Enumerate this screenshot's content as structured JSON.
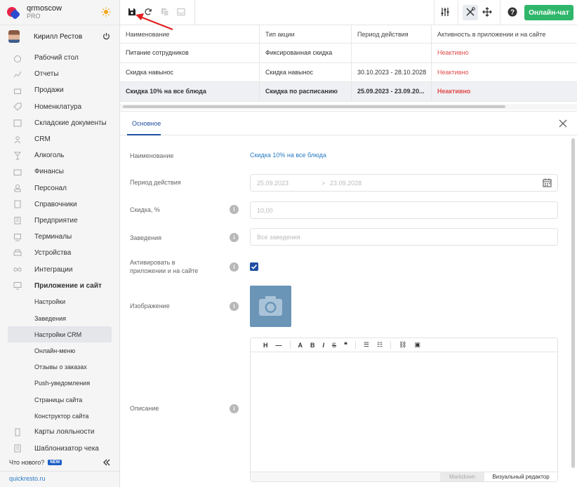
{
  "org": {
    "name": "qrmoscow",
    "plan": "PRO"
  },
  "user": {
    "name": "Кирилл Рестов"
  },
  "nav": {
    "items": [
      {
        "label": "Рабочий стол"
      },
      {
        "label": "Отчеты"
      },
      {
        "label": "Продажи"
      },
      {
        "label": "Номенклатура"
      },
      {
        "label": "Складские документы"
      },
      {
        "label": "CRM"
      },
      {
        "label": "Алкоголь"
      },
      {
        "label": "Финансы"
      },
      {
        "label": "Персонал"
      },
      {
        "label": "Справочники"
      },
      {
        "label": "Предприятие"
      },
      {
        "label": "Терминалы"
      },
      {
        "label": "Устройства"
      },
      {
        "label": "Интеграции"
      },
      {
        "label": "Приложение и сайт"
      }
    ],
    "sub": [
      {
        "label": "Настройки"
      },
      {
        "label": "Заведения"
      },
      {
        "label": "Настройки CRM"
      },
      {
        "label": "Онлайн-меню"
      },
      {
        "label": "Отзывы о заказах"
      },
      {
        "label": "Push-уведомления"
      },
      {
        "label": "Страницы сайта"
      },
      {
        "label": "Конструктор сайта"
      }
    ],
    "after": [
      {
        "label": "Карты лояльности"
      },
      {
        "label": "Шаблонизатор чека"
      }
    ]
  },
  "footer": {
    "whats_new": "Что нового?",
    "badge": "NEW",
    "link": "quickresto.ru"
  },
  "toolbar": {
    "chat_label": "Онлайн-чат",
    "accent": "#2fb66a"
  },
  "table": {
    "headers": [
      "Наименование",
      "Тип акции",
      "Период действия",
      "Активность в приложении и на сайте"
    ],
    "rows": [
      [
        "Питание сотрудников",
        "Фиксированная скидка",
        "",
        "Неактивно"
      ],
      [
        "Скидка навынос",
        "Скидка навынос",
        "30.10.2023 - 28.10.2028",
        "Неактивно"
      ],
      [
        "Скидка 10% на все блюда",
        "Скидка по расписанию",
        "25.09.2023 - 23.09.20...",
        "Неактивно"
      ]
    ]
  },
  "panel": {
    "tab": "Основное",
    "labels": {
      "name": "Наименование",
      "period": "Период действия",
      "discount": "Скидка, %",
      "venues": "Заведения",
      "activate_1": "Активировать в",
      "activate_2": "приложении и на сайте",
      "image": "Изображение",
      "description": "Описание"
    },
    "name_value": "Скидка 10% на все блюда",
    "period_from": "25.09.2023",
    "period_sep": ">",
    "period_to": "23.09.2028",
    "discount_value": "10,00",
    "venues_placeholder": "Все заведения",
    "activate_checked": true,
    "editor": {
      "tools": [
        "H",
        "—",
        "A",
        "B",
        "I",
        "S",
        "❝",
        "☰",
        "☷",
        "⛓",
        "▣"
      ],
      "mode_markdown": "Markdown",
      "mode_visual": "Визуальный редактор"
    }
  }
}
